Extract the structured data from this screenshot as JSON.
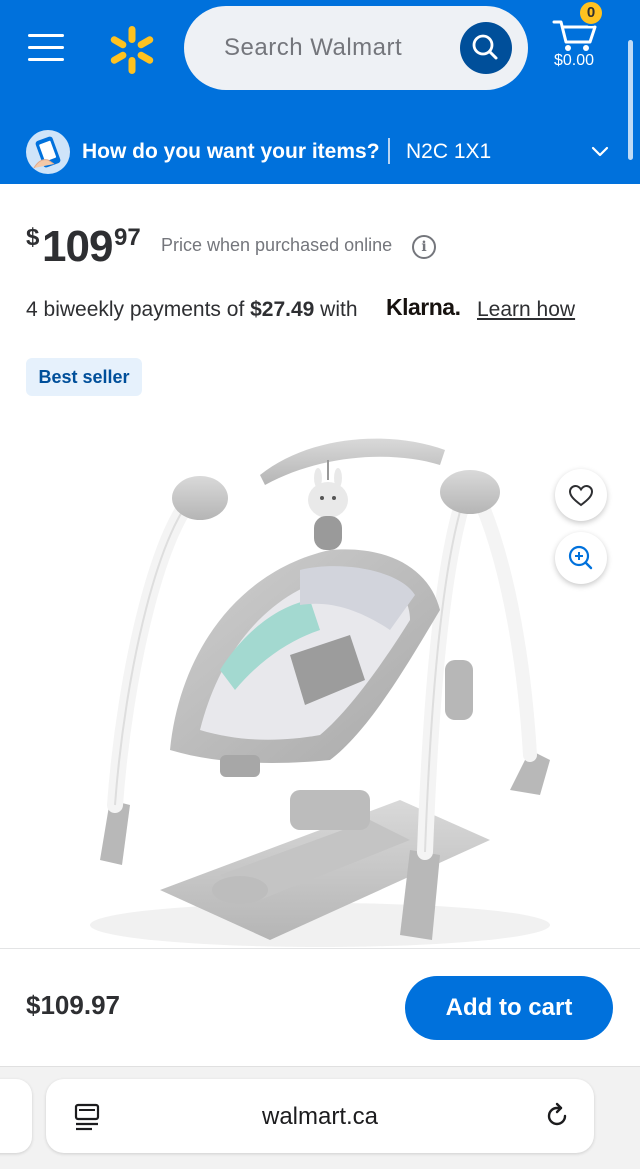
{
  "header": {
    "search_placeholder": "Search Walmart",
    "cart_count": "0",
    "cart_total": "$0.00",
    "brand_color": "#0071dc",
    "spark_color": "#ffc220"
  },
  "delivery": {
    "question": "How do you want your items?",
    "postal_code": "N2C 1X1"
  },
  "product": {
    "price_currency": "$",
    "price_whole": "109",
    "price_cents": "97",
    "price_note": "Price when purchased online",
    "installments_prefix": "4 biweekly payments of ",
    "installment_amount": "$27.49",
    "installments_suffix": " with",
    "klarna_brand": "Klarna.",
    "learn_how": "Learn how",
    "badge": "Best seller",
    "image_subject": "baby-swing"
  },
  "footer": {
    "price": "$109.97",
    "add_to_cart": "Add to cart"
  },
  "browser": {
    "url": "walmart.ca"
  },
  "icons": {
    "menu": "menu-icon",
    "spark": "walmart-spark-icon",
    "search": "search-icon",
    "cart": "cart-icon",
    "info": "info-icon",
    "favorite": "heart-icon",
    "zoom": "zoom-in-icon",
    "tabs": "tabs-icon",
    "reload": "reload-icon"
  }
}
